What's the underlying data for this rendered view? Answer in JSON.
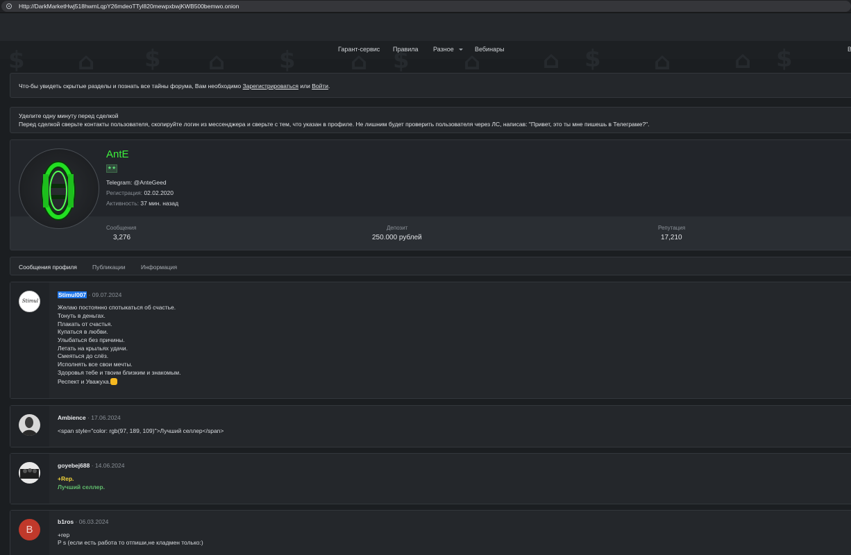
{
  "browser": {
    "url": "Http://DarkMarketHwj518hwmLqpY26mdeoTTyl820mewpxbwjKWB500bemwo.onion"
  },
  "nav": {
    "items": [
      "Гарант-сервис",
      "Правила",
      "Разное",
      "Вебинары"
    ],
    "edge_label": "В"
  },
  "notice_guest": {
    "prefix": "Что-бы увидеть скрытые разделы и познать все тайны форума, Вам необходимо",
    "register_link": "Зарегистрироваться",
    "or": "или",
    "login_link": "Войти",
    "suffix": "."
  },
  "notice_deal": {
    "title": "Уделите одну минуту перед сделкой",
    "text": "Перед сделкой сверьте контакты пользователя, скопируйте логин из мессенджера и сверьте с тем, что указан в профиле. Не лишним будет проверить пользователя через ЛС, написав: \"Привет, это ты мне пишешь в Телеграме?\"."
  },
  "profile": {
    "username": "AntE",
    "telegram": "Telegram: @AnteGeed",
    "registration_label": "Регистрация:",
    "registration_value": "02.02.2020",
    "activity_label": "Активность:",
    "activity_value": "37 мин. назад",
    "stats": [
      {
        "label": "Сообщения",
        "value": "3,276"
      },
      {
        "label": "Депозит",
        "value": "250.000 рублей"
      },
      {
        "label": "Репутация",
        "value": "17,210"
      }
    ],
    "accent_color": "#3df03d"
  },
  "tabs": [
    "Сообщения профиля",
    "Публикации",
    "Информация"
  ],
  "posts": [
    {
      "author": "Stimul007",
      "date": "09.07.2024",
      "lines": [
        "Желаю постоянно спотыкаться об счастье.",
        "Тонуть в деньгах.",
        "Плакать от счастья.",
        "Купаться в любви.",
        "Улыбаться без причины.",
        "Летать на крыльях удачи.",
        "Смеяться до слёз.",
        "Исполнять все свои мечты.",
        "Здоровья тебе и твоим близким и знакомым.",
        "Респект и Уважуха."
      ],
      "avatar_text": "Stimul"
    },
    {
      "author": "Ambience",
      "date": "17.06.2024",
      "lines": [
        "<span style=\"color: rgb(97, 189, 109)\">Лучший селлер</span>"
      ]
    },
    {
      "author": "goyebej688",
      "date": "14.06.2024",
      "lines": [
        "+Rep.",
        "Лучший селлер."
      ]
    },
    {
      "author": "b1ros",
      "date": "06.03.2024",
      "lines": [
        "+rep",
        "P s (если есть работа то отпиши,не кладмен только:)"
      ],
      "avatar_letter": "B"
    }
  ]
}
